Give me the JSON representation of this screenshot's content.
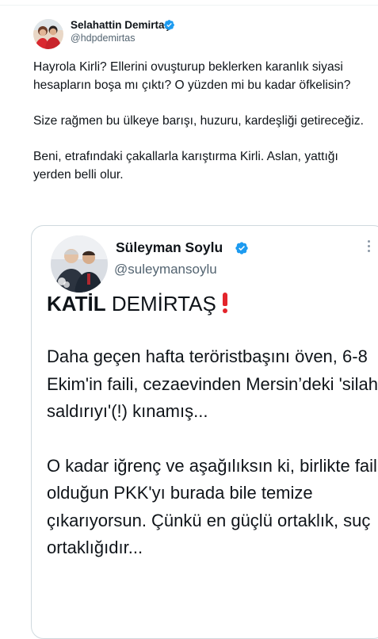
{
  "tweet": {
    "author_name": "Selahattin Demirtaş",
    "author_handle": "@hdpdemirtas",
    "paragraphs": [
      "Hayrola Kirli? Ellerini ovuşturup beklerken karanlık siyasi hesapların boşa mı çıktı? O yüzden mi bu kadar öfkelisin?",
      "Size rağmen bu ülkeye barışı, huzuru, kardeşliği getireceğiz.",
      "Beni, etrafındaki çakallarla karıştırma Kirli. Aslan, yattığı yerden belli olur."
    ]
  },
  "quoted_tweet": {
    "author_name": "Süleyman Soylu",
    "author_handle": "@suleymansoylu",
    "title_bold": "KATİL",
    "title_rest": " DEMİRTAŞ",
    "paragraphs": [
      "Daha geçen hafta teröristbaşını öven, 6-8 Ekim'in faili, cezaevinden Mersin’deki 'silahlı saldırıyı'(!) kınamış...",
      "O kadar iğrenç ve aşağılıksın ki, birlikte fail olduğun PKK'yı burada bile temize çıkarıyorsun. Çünkü en güçlü ortaklık, suç ortaklığıdır..."
    ]
  },
  "colors": {
    "verified_blue": "#1d9bf0",
    "secondary_text": "#536471",
    "card_border": "#cfd9de",
    "emoji_red": "#e3242b"
  },
  "icons": {
    "verified": "verified-badge-icon",
    "more": "more-options-icon",
    "exclamation": "red-exclamation-mark-icon"
  }
}
